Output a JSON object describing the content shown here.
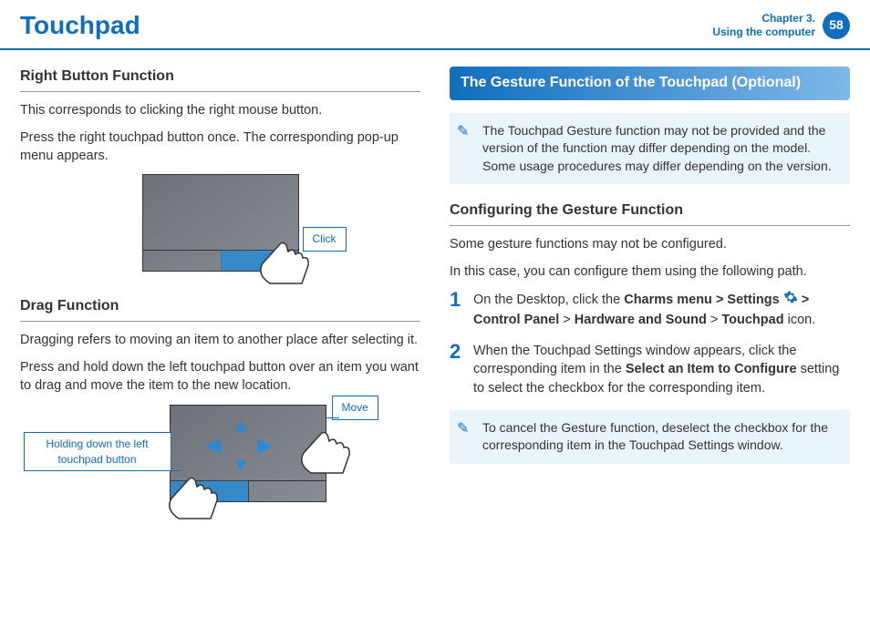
{
  "header": {
    "title": "Touchpad",
    "chapter_line1": "Chapter 3.",
    "chapter_line2": "Using the computer",
    "page_number": "58"
  },
  "left": {
    "right_button": {
      "heading": "Right Button Function",
      "p1": "This corresponds to clicking the right mouse button.",
      "p2": "Press the right touchpad button once. The corresponding pop-up menu appears.",
      "callout_click": "Click"
    },
    "drag": {
      "heading": "Drag Function",
      "p1": "Dragging refers to moving an item to another place after selecting it.",
      "p2": "Press and hold down the left touchpad button over an item you want to drag and move the item to the new location.",
      "callout_hold": "Holding down the left touchpad button",
      "callout_move": "Move"
    }
  },
  "right": {
    "gesture_bar": "The Gesture Function of the Touchpad (Optional)",
    "note1": "The Touchpad Gesture function may not be provided and the version of the function may differ depending on the model. Some usage procedures may differ depending on the version.",
    "config_heading": "Configuring the Gesture Function",
    "config_p1": "Some gesture functions may not be configured.",
    "config_p2": "In this case, you can configure them using the following path.",
    "step1_a": "On the Desktop, click the ",
    "step1_b_bold": "Charms menu > Settings",
    "step1_c": " > ",
    "step1_d_bold": "Control Panel",
    "step1_e": " > ",
    "step1_f_bold": "Hardware and Sound",
    "step1_g": " > ",
    "step1_h_bold": "Touchpad",
    "step1_i": " icon.",
    "step2_a": "When the Touchpad Settings window appears, click the corresponding item in the ",
    "step2_b_bold": "Select an Item to Configure",
    "step2_c": " setting to select the checkbox for the corresponding item.",
    "note2": "To cancel the Gesture function, deselect the checkbox for the corresponding item in the Touchpad Settings window.",
    "step_num_1": "1",
    "step_num_2": "2"
  }
}
